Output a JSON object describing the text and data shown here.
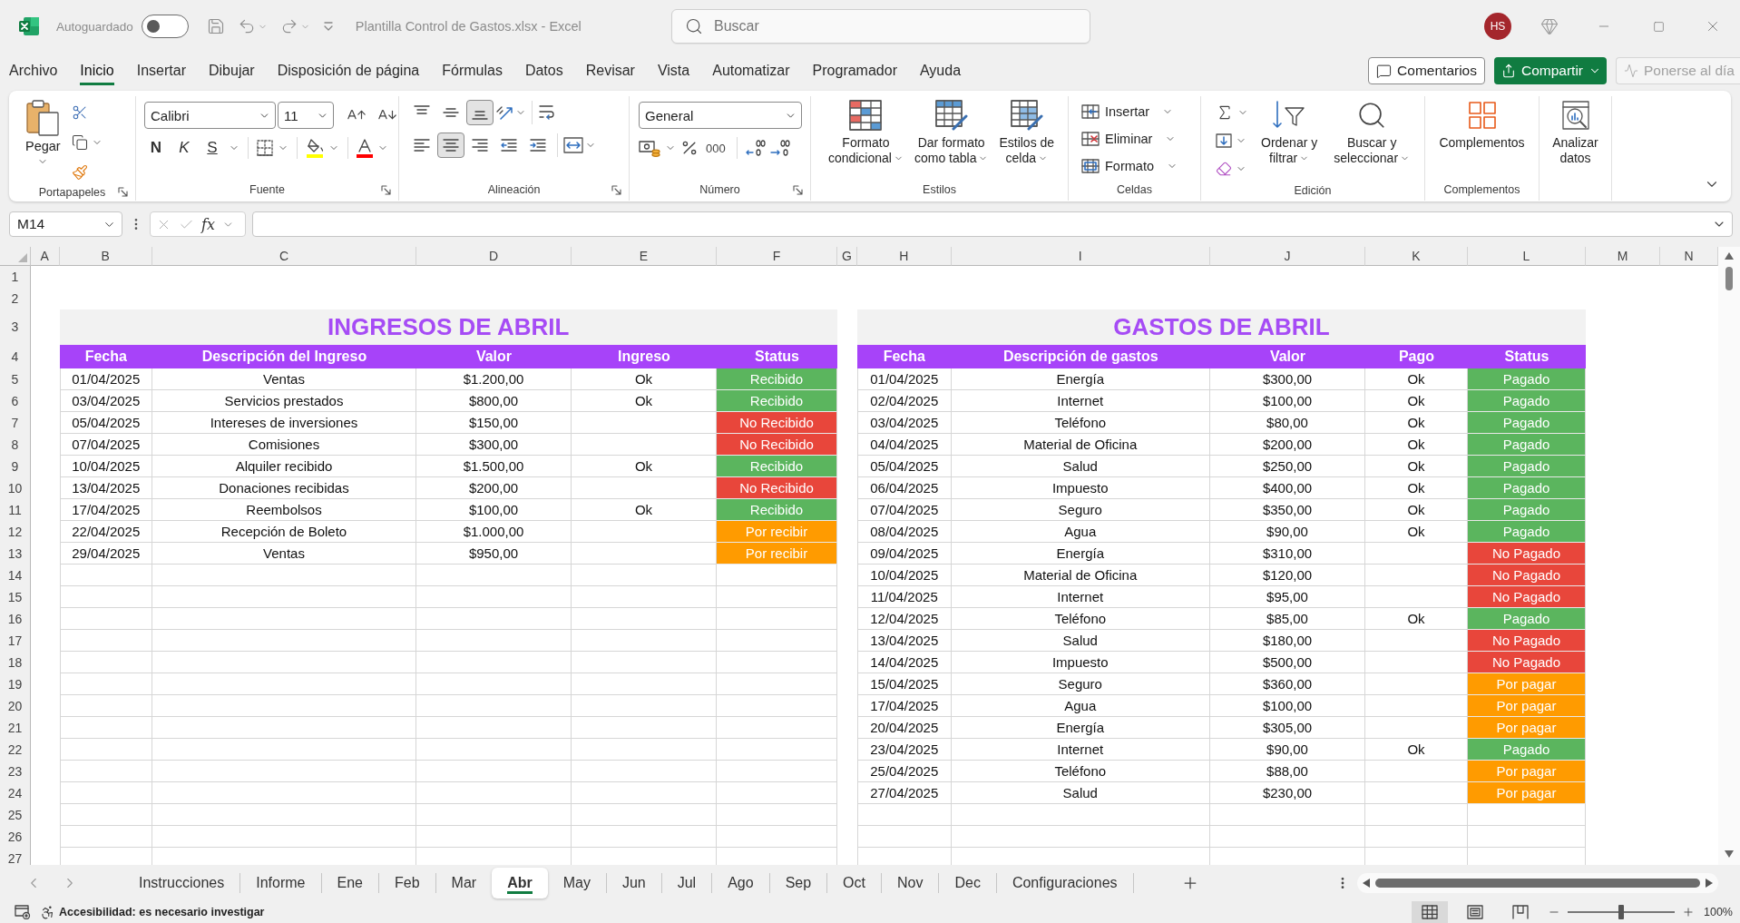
{
  "window": {
    "title": "Plantilla Control de Gastos.xlsx - Excel",
    "autosave": {
      "label": "Autoguardado",
      "on": false
    },
    "search": {
      "placeholder": "Buscar"
    },
    "avatar": "HS"
  },
  "menu": {
    "tabs": [
      {
        "label": "Archivo",
        "selected": false
      },
      {
        "label": "Inicio",
        "selected": true
      },
      {
        "label": "Insertar",
        "selected": false
      },
      {
        "label": "Dibujar",
        "selected": false
      },
      {
        "label": "Disposición de página",
        "selected": false
      },
      {
        "label": "Fórmulas",
        "selected": false
      },
      {
        "label": "Datos",
        "selected": false
      },
      {
        "label": "Revisar",
        "selected": false
      },
      {
        "label": "Vista",
        "selected": false
      },
      {
        "label": "Automatizar",
        "selected": false
      },
      {
        "label": "Programador",
        "selected": false
      },
      {
        "label": "Ayuda",
        "selected": false
      }
    ],
    "comments": "Comentarios",
    "share": "Compartir",
    "catch_up": {
      "label": "Ponerse al día",
      "disabled": true
    }
  },
  "ribbon": {
    "clipboard": {
      "label": "Portapapeles",
      "paste": "Pegar"
    },
    "font": {
      "label": "Fuente",
      "name": "Calibri",
      "size": "11",
      "bold": "N",
      "italic": "K",
      "underline": "S"
    },
    "alignment": {
      "label": "Alineación",
      "vertical": [
        {
          "kind": "top",
          "selected": false
        },
        {
          "kind": "middle",
          "selected": false
        },
        {
          "kind": "bottom",
          "selected": true
        }
      ],
      "horizontal": [
        {
          "kind": "left",
          "selected": false
        },
        {
          "kind": "center",
          "selected": true
        },
        {
          "kind": "right",
          "selected": false
        }
      ]
    },
    "number": {
      "label": "Número",
      "format": "General",
      "thousands": "000"
    },
    "styles": {
      "label": "Estilos",
      "buttons": [
        {
          "kind": "conditional",
          "lines": [
            "Formato",
            "condicional"
          ]
        },
        {
          "kind": "table",
          "lines": [
            "Dar formato",
            "como tabla"
          ]
        },
        {
          "kind": "cell",
          "lines": [
            "Estilos de",
            "celda"
          ]
        }
      ]
    },
    "cells": {
      "label": "Celdas",
      "buttons": [
        {
          "kind": "insert",
          "label": "Insertar"
        },
        {
          "kind": "delete",
          "label": "Eliminar"
        },
        {
          "kind": "format",
          "label": "Formato"
        }
      ]
    },
    "editing": {
      "label": "Edición",
      "buttons": [
        {
          "kind": "sort",
          "lines": [
            "Ordenar y",
            "filtrar"
          ]
        },
        {
          "kind": "find",
          "lines": [
            "Buscar y",
            "seleccionar"
          ]
        }
      ]
    },
    "addins": {
      "label": "Complementos",
      "button": "Complementos"
    },
    "analysis": {
      "lines": [
        "Analizar",
        "datos"
      ]
    }
  },
  "formula_bar": {
    "name_box": "M14",
    "function_label": "fx"
  },
  "sheet": {
    "columns": [
      "A",
      "B",
      "C",
      "D",
      "E",
      "F",
      "G",
      "H",
      "I",
      "J",
      "K",
      "L",
      "M",
      "N"
    ],
    "rows": [
      "1",
      "2",
      "3",
      "4",
      "5",
      "6",
      "7",
      "8",
      "9",
      "10",
      "11",
      "12",
      "13",
      "14",
      "15",
      "16",
      "17",
      "18",
      "19",
      "20",
      "21",
      "22",
      "23",
      "24",
      "25",
      "26",
      "27"
    ],
    "tables": [
      {
        "title": "INGRESOS DE ABRIL",
        "columns": [
          "Fecha",
          "Descripción del Ingreso",
          "Valor",
          "Ingreso",
          "Status"
        ],
        "rows": [
          {
            "date": "01/04/2025",
            "description": "Ventas",
            "value": "$1.200,00",
            "check": "Ok",
            "status": "Recibido",
            "color": "#5bb55e"
          },
          {
            "date": "03/04/2025",
            "description": "Servicios prestados",
            "value": "$800,00",
            "check": "Ok",
            "status": "Recibido",
            "color": "#5bb55e"
          },
          {
            "date": "05/04/2025",
            "description": "Intereses de inversiones",
            "value": "$150,00",
            "status": "No Recibido",
            "color": "#e8463b"
          },
          {
            "date": "07/04/2025",
            "description": "Comisiones",
            "value": "$300,00",
            "status": "No Recibido",
            "color": "#e8463b"
          },
          {
            "date": "10/04/2025",
            "description": "Alquiler recibido",
            "value": "$1.500,00",
            "check": "Ok",
            "status": "Recibido",
            "color": "#5bb55e"
          },
          {
            "date": "13/04/2025",
            "description": "Donaciones recibidas",
            "value": "$200,00",
            "status": "No Recibido",
            "color": "#e8463b"
          },
          {
            "date": "17/04/2025",
            "description": "Reembolsos",
            "value": "$100,00",
            "check": "Ok",
            "status": "Recibido",
            "color": "#5bb55e"
          },
          {
            "date": "22/04/2025",
            "description": "Recepción de Boleto",
            "value": "$1.000,00",
            "status": "Por recibir",
            "color": "#ff9b00"
          },
          {
            "date": "29/04/2025",
            "description": "Ventas",
            "value": "$950,00",
            "status": "Por recibir",
            "color": "#ff9b00"
          }
        ]
      },
      {
        "title": "GASTOS DE ABRIL",
        "columns": [
          "Fecha",
          "Descripción de gastos",
          "Valor",
          "Pago",
          "Status"
        ],
        "rows": [
          {
            "date": "01/04/2025",
            "description": "Energía",
            "value": "$300,00",
            "check": "Ok",
            "status": "Pagado",
            "color": "#5bb55e"
          },
          {
            "date": "02/04/2025",
            "description": "Internet",
            "value": "$100,00",
            "check": "Ok",
            "status": "Pagado",
            "color": "#5bb55e"
          },
          {
            "date": "03/04/2025",
            "description": "Teléfono",
            "value": "$80,00",
            "check": "Ok",
            "status": "Pagado",
            "color": "#5bb55e"
          },
          {
            "date": "04/04/2025",
            "description": "Material de Oficina",
            "value": "$200,00",
            "check": "Ok",
            "status": "Pagado",
            "color": "#5bb55e"
          },
          {
            "date": "05/04/2025",
            "description": "Salud",
            "value": "$250,00",
            "check": "Ok",
            "status": "Pagado",
            "color": "#5bb55e"
          },
          {
            "date": "06/04/2025",
            "description": "Impuesto",
            "value": "$400,00",
            "check": "Ok",
            "status": "Pagado",
            "color": "#5bb55e"
          },
          {
            "date": "07/04/2025",
            "description": "Seguro",
            "value": "$350,00",
            "check": "Ok",
            "status": "Pagado",
            "color": "#5bb55e"
          },
          {
            "date": "08/04/2025",
            "description": "Agua",
            "value": "$90,00",
            "check": "Ok",
            "status": "Pagado",
            "color": "#5bb55e"
          },
          {
            "date": "09/04/2025",
            "description": "Energía",
            "value": "$310,00",
            "status": "No Pagado",
            "color": "#e8463b"
          },
          {
            "date": "10/04/2025",
            "description": "Material de Oficina",
            "value": "$120,00",
            "status": "No Pagado",
            "color": "#e8463b"
          },
          {
            "date": "11/04/2025",
            "description": "Internet",
            "value": "$95,00",
            "status": "No Pagado",
            "color": "#e8463b"
          },
          {
            "date": "12/04/2025",
            "description": "Teléfono",
            "value": "$85,00",
            "check": "Ok",
            "status": "Pagado",
            "color": "#5bb55e"
          },
          {
            "date": "13/04/2025",
            "description": "Salud",
            "value": "$180,00",
            "status": "No Pagado",
            "color": "#e8463b"
          },
          {
            "date": "14/04/2025",
            "description": "Impuesto",
            "value": "$500,00",
            "status": "No Pagado",
            "color": "#e8463b"
          },
          {
            "date": "15/04/2025",
            "description": "Seguro",
            "value": "$360,00",
            "status": "Por pagar",
            "color": "#ff9b00"
          },
          {
            "date": "17/04/2025",
            "description": "Agua",
            "value": "$100,00",
            "status": "Por pagar",
            "color": "#ff9b00"
          },
          {
            "date": "20/04/2025",
            "description": "Energía",
            "value": "$305,00",
            "status": "Por pagar",
            "color": "#ff9b00"
          },
          {
            "date": "23/04/2025",
            "description": "Internet",
            "value": "$90,00",
            "check": "Ok",
            "status": "Pagado",
            "color": "#5bb55e"
          },
          {
            "date": "25/04/2025",
            "description": "Teléfono",
            "value": "$88,00",
            "status": "Por pagar",
            "color": "#ff9b00"
          },
          {
            "date": "27/04/2025",
            "description": "Salud",
            "value": "$230,00",
            "status": "Por pagar",
            "color": "#ff9b00"
          }
        ]
      }
    ]
  },
  "sheet_tabs": [
    {
      "label": "Instrucciones",
      "selected": false
    },
    {
      "label": "Informe",
      "selected": false
    },
    {
      "label": "Ene",
      "selected": false
    },
    {
      "label": "Feb",
      "selected": false
    },
    {
      "label": "Mar",
      "selected": false
    },
    {
      "label": "Abr",
      "selected": true
    },
    {
      "label": "May",
      "selected": false
    },
    {
      "label": "Jun",
      "selected": false
    },
    {
      "label": "Jul",
      "selected": false
    },
    {
      "label": "Ago",
      "selected": false
    },
    {
      "label": "Sep",
      "selected": false
    },
    {
      "label": "Oct",
      "selected": false
    },
    {
      "label": "Nov",
      "selected": false
    },
    {
      "label": "Dec",
      "selected": false
    },
    {
      "label": "Configuraciones",
      "selected": false
    }
  ],
  "status_bar": {
    "accessibility": "Accesibilidad: es necesario investigar",
    "views": [
      {
        "kind": "normal",
        "selected": true
      },
      {
        "kind": "page_layout",
        "selected": false
      },
      {
        "kind": "page_break",
        "selected": false
      }
    ],
    "zoom": {
      "level": 0.5,
      "reading": "100%"
    }
  }
}
